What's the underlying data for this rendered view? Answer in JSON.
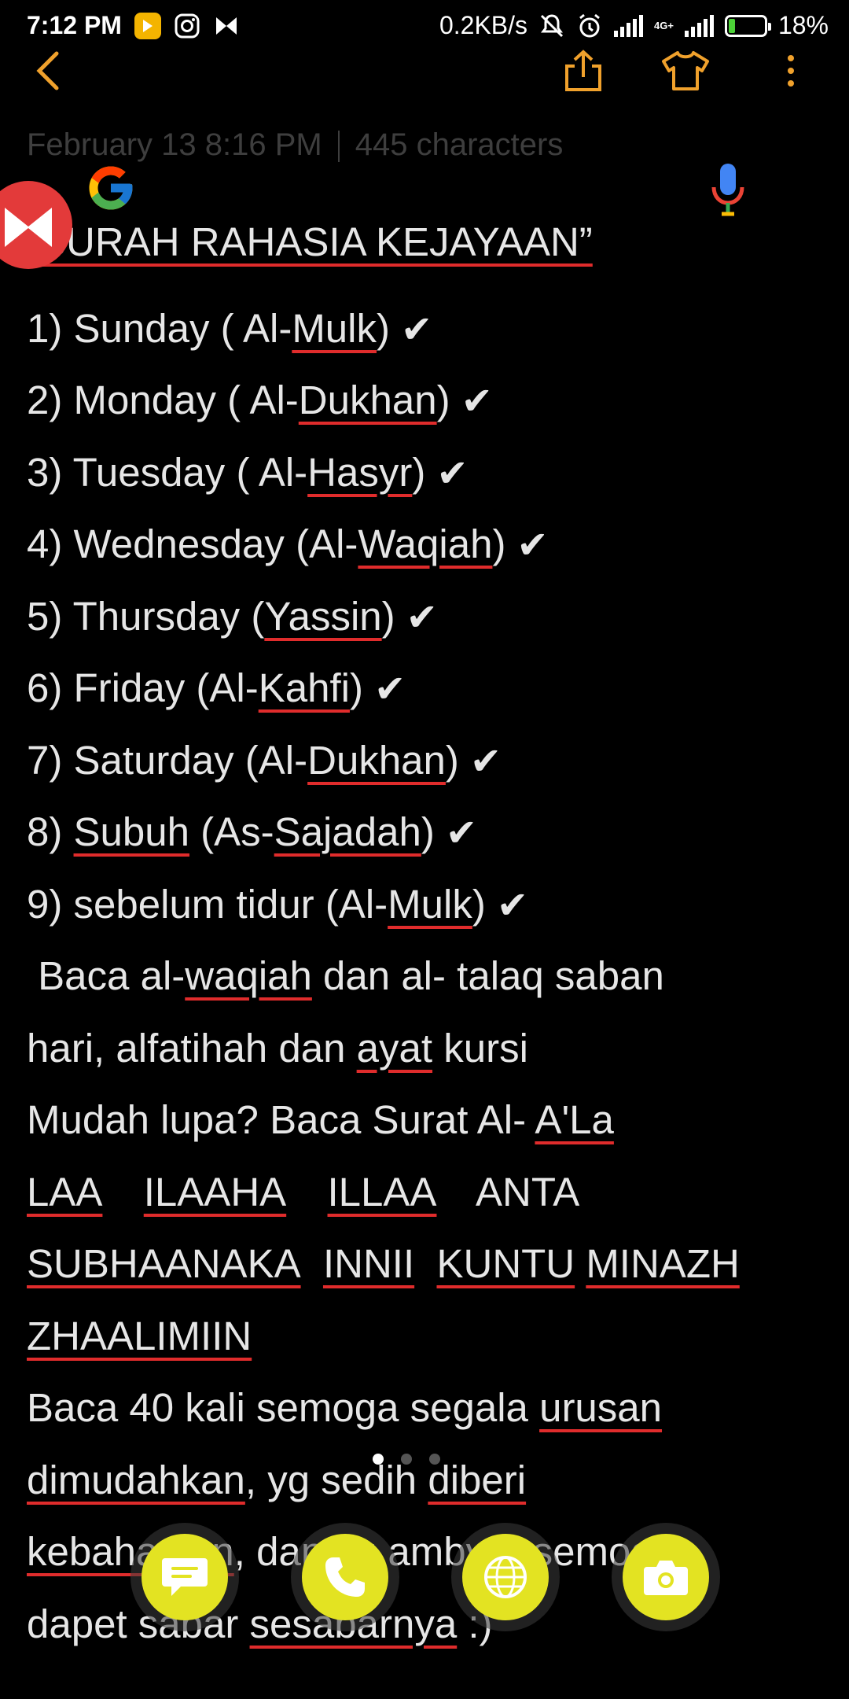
{
  "status_bar": {
    "time": "7:12 PM",
    "speed": "0.2KB/s",
    "network": "4G+",
    "battery": "18%"
  },
  "note": {
    "meta_date": "February 13  8:16 PM",
    "meta_chars": "445 characters",
    "title": "SURAH RAHASIA KEJAYAAN”",
    "check_glyph": "✔",
    "items": [
      {
        "pre": "1) Sunday ( Al-",
        "word": "Mulk",
        "post": ")"
      },
      {
        "pre": "2) Monday  ( Al-",
        "word": "Dukhan",
        "post": ")"
      },
      {
        "pre": "3) Tuesday ( Al-",
        "word": "Hasyr",
        "post": ")"
      },
      {
        "pre": "4) Wednesday (Al-",
        "word": "Waqiah",
        "post": ")"
      },
      {
        "pre": "5) Thursday (",
        "word": "Yassin",
        "post": ")"
      },
      {
        "pre": "6) Friday (Al-",
        "word": "Kahfi",
        "post": ")"
      },
      {
        "pre": "7) Saturday (Al-",
        "word": "Dukhan",
        "post": ")"
      },
      {
        "pre": "8) ",
        "word": "Subuh",
        "mid": " (As-",
        "word2": "Sajadah",
        "post": ")"
      },
      {
        "pre": "9) sebelum tidur (Al-",
        "word": "Mulk",
        "post": ")"
      }
    ],
    "para": [
      {
        "a": " Baca al-",
        "u1": "waqiah",
        "b": " dan al- talaq saban"
      },
      {
        "a": "hari, alfatihah dan ",
        "u1": "ayat",
        "b": " kursi"
      },
      {
        "a": "Mudah lupa? Baca Surat Al- ",
        "u1": "A'La",
        "b": ""
      }
    ],
    "dua_1": {
      "w1": "LAA",
      "w2": "ILAAHA",
      "w3": "ILLAA",
      "w4": "ANTA"
    },
    "dua_2": {
      "w1": "SUBHAANAKA",
      "w2": "INNII",
      "w3": "KUNTU",
      "w4": "MINAZH"
    },
    "dua_3": "ZHAALIMIIN",
    "end_1": {
      "a": "Baca 40 kali semoga segala ",
      "u": "urusan"
    },
    "end_2": {
      "u1": "dimudahkan",
      "a": ", yg sedih ",
      "u2": "diberi"
    },
    "end_3": {
      "u1": "kebahagian",
      "a": ", dan yg ambyar semoga"
    },
    "end_4": {
      "a": "dapet sabar ",
      "u": "sesabarnya",
      "b": " :)"
    }
  },
  "icons": {
    "back": "chevron-left-icon",
    "share": "share-icon",
    "theme": "shirt-icon",
    "more": "more-vert-icon",
    "google": "google-icon",
    "mic": "mic-icon",
    "chathead": "messenger-icon",
    "dock": [
      "message-icon",
      "phone-icon",
      "browser-icon",
      "camera-icon"
    ]
  },
  "colors": {
    "accent": "#f0a12c",
    "underline": "#e02c2c",
    "dock": "#e3e322",
    "background": "#000000"
  }
}
